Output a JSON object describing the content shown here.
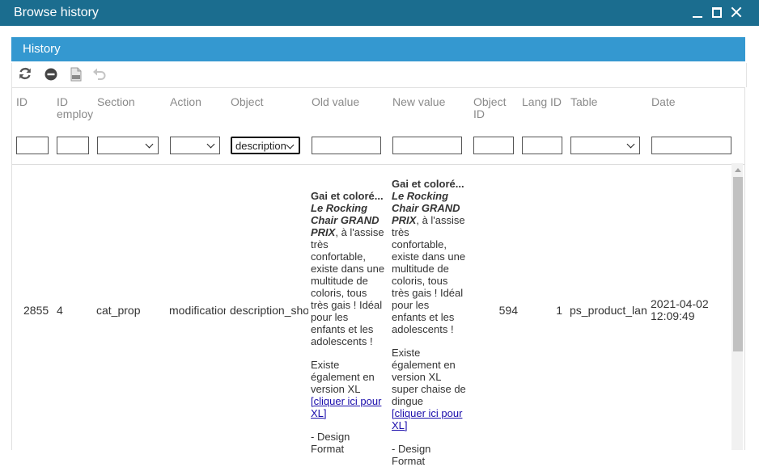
{
  "window": {
    "title": "Browse history"
  },
  "panel": {
    "title": "History"
  },
  "toolbar": {
    "icons": [
      "refresh-icon",
      "remove-icon",
      "csv-export-icon",
      "undo-icon"
    ]
  },
  "columns": {
    "id": "ID",
    "id_employee": "ID employee",
    "section": "Section",
    "action": "Action",
    "object": "Object",
    "old_value": "Old value",
    "new_value": "New value",
    "object_id": "Object ID",
    "lang_id": "Lang ID",
    "table": "Table",
    "date": "Date"
  },
  "filters": {
    "object_selected": "description_short"
  },
  "row": {
    "id": "2855",
    "id_employee": "4",
    "section": "cat_prop",
    "action": "modification",
    "object": "description_short",
    "object_id": "594",
    "lang_id": "1",
    "table": "ps_product_lang",
    "date_line1": "2021-04-02",
    "date_line2": "12:09:49",
    "old_value": {
      "lead": "Gai et coloré...",
      "name": "Le Rocking Chair GRAND PRIX",
      "body": ", à l'assise très confortable, existe dans une multitude de coloris, tous très gais ! Idéal pour les enfants et les adolescents !",
      "p2": "Existe également en version XL",
      "link": "[cliquer ici pour XL]",
      "p3": "- Design Format"
    },
    "new_value": {
      "lead": "Gai et coloré...",
      "name": "Le Rocking Chair GRAND PRIX",
      "body": ", à l'assise très confortable, existe dans une multitude de coloris, tous très gais ! Idéal pour les enfants et les adolescents !",
      "p2": "Existe également en version XL super chaise de dingue",
      "link": "[cliquer ici pour XL]",
      "p3": "- Design Format"
    }
  }
}
